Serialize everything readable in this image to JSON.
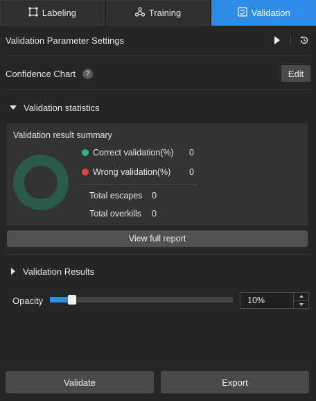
{
  "tabs": [
    {
      "label": "Labeling",
      "icon": "labeling-icon",
      "active": false
    },
    {
      "label": "Training",
      "icon": "training-icon",
      "active": false
    },
    {
      "label": "Validation",
      "icon": "validation-icon",
      "active": true
    }
  ],
  "header": {
    "title": "Validation Parameter Settings",
    "run_icon": "play-icon",
    "history_icon": "history-icon"
  },
  "confidence": {
    "label": "Confidence Chart",
    "help": "?",
    "edit_label": "Edit"
  },
  "statistics": {
    "title": "Validation statistics",
    "summary_title": "Validation result summary",
    "legend": [
      {
        "label": "Correct validation(%)",
        "value": "0",
        "color": "#2fb37a"
      },
      {
        "label": "Wrong validation(%)",
        "value": "0",
        "color": "#d24a3a"
      }
    ],
    "totals": [
      {
        "label": "Total escapes",
        "value": "0"
      },
      {
        "label": "Total overkills",
        "value": "0"
      }
    ],
    "donut_color": "#2a5a4a",
    "report_button": "View full report"
  },
  "results": {
    "title": "Validation Results"
  },
  "opacity": {
    "label": "Opacity",
    "value": 10,
    "display": "10%"
  },
  "actions": {
    "validate": "Validate",
    "export": "Export"
  },
  "colors": {
    "accent": "#2e8ce6",
    "background": "#262626",
    "panel": "#333333"
  }
}
